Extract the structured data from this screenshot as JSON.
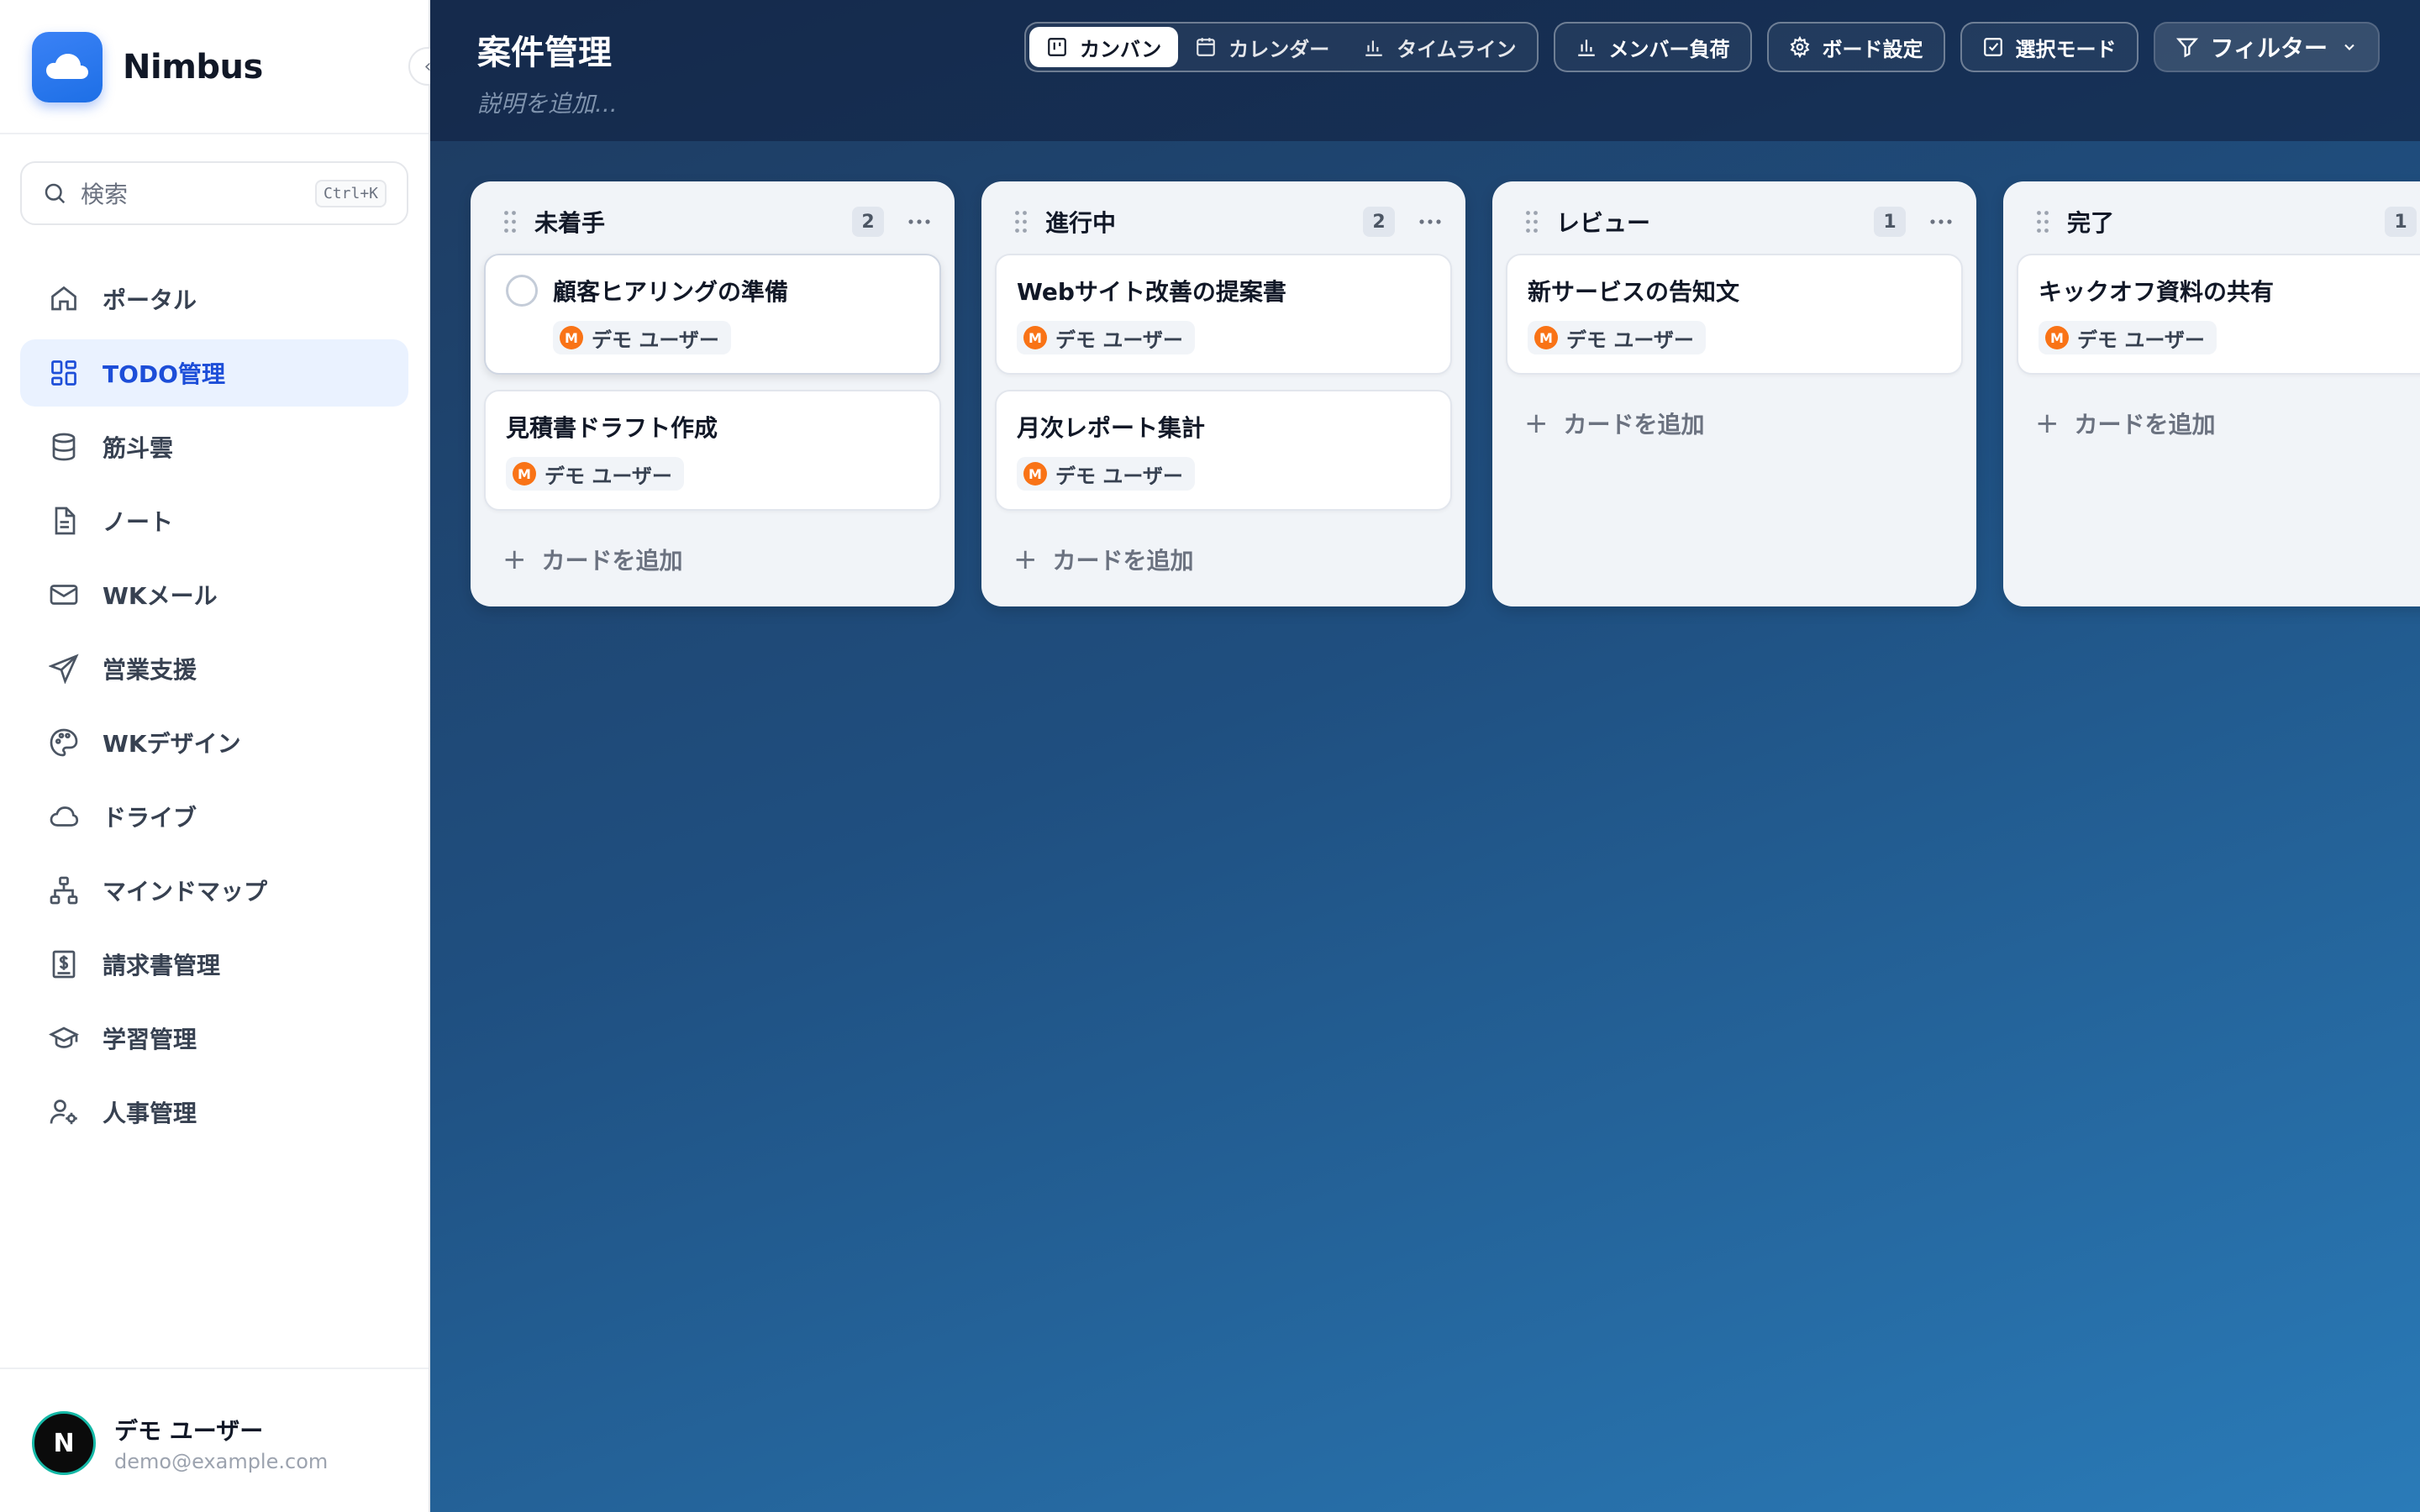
{
  "app": {
    "name": "Nimbus"
  },
  "search": {
    "placeholder": "検索",
    "shortcut": "Ctrl+K"
  },
  "sidebar": {
    "items": [
      {
        "label": "ポータル",
        "icon": "home-icon"
      },
      {
        "label": "TODO管理",
        "icon": "grid-icon",
        "active": true
      },
      {
        "label": "筋斗雲",
        "icon": "database-icon"
      },
      {
        "label": "ノート",
        "icon": "file-text-icon"
      },
      {
        "label": "WKメール",
        "icon": "mail-icon"
      },
      {
        "label": "営業支援",
        "icon": "send-icon"
      },
      {
        "label": "WKデザイン",
        "icon": "palette-icon"
      },
      {
        "label": "ドライブ",
        "icon": "cloud-icon"
      },
      {
        "label": "マインドマップ",
        "icon": "network-icon"
      },
      {
        "label": "請求書管理",
        "icon": "invoice-icon"
      },
      {
        "label": "学習管理",
        "icon": "graduation-cap-icon"
      },
      {
        "label": "人事管理",
        "icon": "user-cog-icon"
      }
    ]
  },
  "user": {
    "name": "デモ ユーザー",
    "email": "demo@example.com",
    "initial": "N"
  },
  "header": {
    "title": "案件管理",
    "description_placeholder": "説明を追加...",
    "views": [
      {
        "label": "カンバン",
        "icon": "kanban-icon",
        "active": true
      },
      {
        "label": "カレンダー",
        "icon": "calendar-icon"
      },
      {
        "label": "タイムライン",
        "icon": "timeline-icon"
      }
    ],
    "buttons": {
      "member_load": "メンバー負荷",
      "board_settings": "ボード設定",
      "select_mode": "選択モード",
      "filter": "フィルター"
    }
  },
  "board": {
    "add_card_label": "カードを追加",
    "columns": [
      {
        "title": "未着手",
        "count": "2",
        "cards": [
          {
            "title": "顧客ヒアリングの準備",
            "assignee": "デモ ユーザー",
            "assignee_initial": "M"
          },
          {
            "title": "見積書ドラフト作成",
            "assignee": "デモ ユーザー",
            "assignee_initial": "M"
          }
        ]
      },
      {
        "title": "進行中",
        "count": "2",
        "cards": [
          {
            "title": "Webサイト改善の提案書",
            "assignee": "デモ ユーザー",
            "assignee_initial": "M"
          },
          {
            "title": "月次レポート集計",
            "assignee": "デモ ユーザー",
            "assignee_initial": "M"
          }
        ]
      },
      {
        "title": "レビュー",
        "count": "1",
        "cards": [
          {
            "title": "新サービスの告知文",
            "assignee": "デモ ユーザー",
            "assignee_initial": "M"
          }
        ]
      },
      {
        "title": "完了",
        "count": "1",
        "cards": [
          {
            "title": "キックオフ資料の共有",
            "assignee": "デモ ユーザー",
            "assignee_initial": "M"
          }
        ]
      }
    ]
  }
}
